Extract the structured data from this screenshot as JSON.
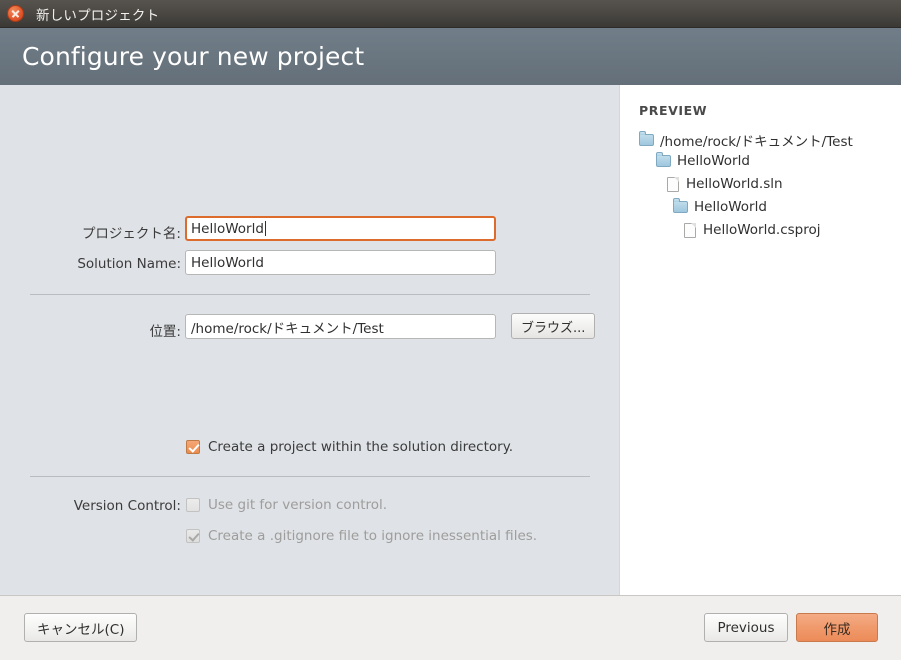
{
  "window": {
    "title": "新しいプロジェクト",
    "close_icon": "close-icon"
  },
  "header": {
    "title": "Configure your new project"
  },
  "form": {
    "project_name": {
      "label": "プロジェクト名:",
      "value": "HelloWorld",
      "placeholder": ""
    },
    "solution_name": {
      "label": "Solution Name:",
      "value": "HelloWorld",
      "placeholder": ""
    },
    "location": {
      "label": "位置:",
      "value": "/home/rock/ドキュメント/Test",
      "placeholder": "",
      "browse_label": "ブラウズ..."
    },
    "create_in_solution_dir": {
      "label": "Create a project within the solution directory.",
      "checked": true
    },
    "version_control": {
      "label": "Version Control:",
      "use_git": {
        "label": "Use git for version control.",
        "checked": false,
        "disabled": true
      },
      "gitignore": {
        "label": "Create a .gitignore file to ignore inessential files.",
        "checked": true,
        "disabled": true
      }
    }
  },
  "preview": {
    "title": "PREVIEW",
    "nodes": [
      {
        "label": "/home/rock/ドキュメント/Test",
        "type": "folder",
        "depth": 0
      },
      {
        "label": "HelloWorld",
        "type": "folder",
        "depth": 1
      },
      {
        "label": "HelloWorld.sln",
        "type": "file",
        "depth": 2
      },
      {
        "label": "HelloWorld",
        "type": "folder",
        "depth": 2
      },
      {
        "label": "HelloWorld.csproj",
        "type": "file",
        "depth": 3
      }
    ]
  },
  "footer": {
    "cancel_label": "キャンセル(C)",
    "previous_label": "Previous",
    "create_label": "作成"
  },
  "colors": {
    "accent": "#ec8b59",
    "header_band": "#69757f",
    "titlebar": "#4a4743",
    "panel_bg": "#dfe2e6",
    "focus_border": "#dd6b2b"
  }
}
